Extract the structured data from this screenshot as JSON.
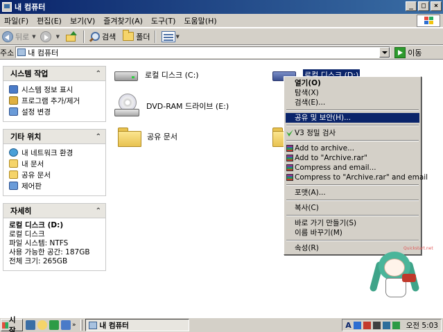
{
  "window": {
    "title": "내 컴퓨터"
  },
  "menu": [
    "파일(F)",
    "편집(E)",
    "보기(V)",
    "즐겨찾기(A)",
    "도구(T)",
    "도움말(H)"
  ],
  "toolbar": {
    "back": "뒤로",
    "search": "검색",
    "folders": "폴더"
  },
  "address": {
    "label": "주소",
    "value": "내 컴퓨터",
    "go": "이동"
  },
  "panels": {
    "system": {
      "title": "시스템 작업",
      "items": [
        "시스템 정보 표시",
        "프로그램 추가/제거",
        "설정 변경"
      ]
    },
    "other": {
      "title": "기타 위치",
      "items": [
        "내 네트워크 환경",
        "내 문서",
        "공유 문서",
        "제어판"
      ]
    },
    "details": {
      "title": "자세히",
      "name": "로컬 디스크 (D:)",
      "type": "로컬 디스크",
      "fs": "파일 시스템: NTFS",
      "free": "사용 가능한 공간: 187GB",
      "total": "전체 크기: 265GB"
    }
  },
  "items": {
    "c_drive": "로컬 디스크 (C:)",
    "d_drive": "로컬 디스크 (D:)",
    "e_drive": "DVD-RAM 드라이브 (E:)",
    "shared": "공유 문서"
  },
  "context_menu": {
    "open": "열기(O)",
    "explore": "탐색(X)",
    "search": "검색(E)...",
    "share": "공유 및 보안(H)...",
    "v3": "V3 정밀 검사",
    "rar_add": "Add to archive...",
    "rar_add_named": "Add to \"Archive.rar\"",
    "rar_email": "Compress and email...",
    "rar_email_named": "Compress to \"Archive.rar\" and email",
    "format": "포맷(A)...",
    "copy": "복사(C)",
    "shortcut": "바로 가기 만들기(S)",
    "rename": "이름 바꾸기(M)",
    "properties": "속성(R)"
  },
  "mascot_tag": "Quickstart.net",
  "taskbar": {
    "start": "시작",
    "task": "내 컴퓨터",
    "clock": "오전 5:03",
    "tray_letter": "A"
  }
}
